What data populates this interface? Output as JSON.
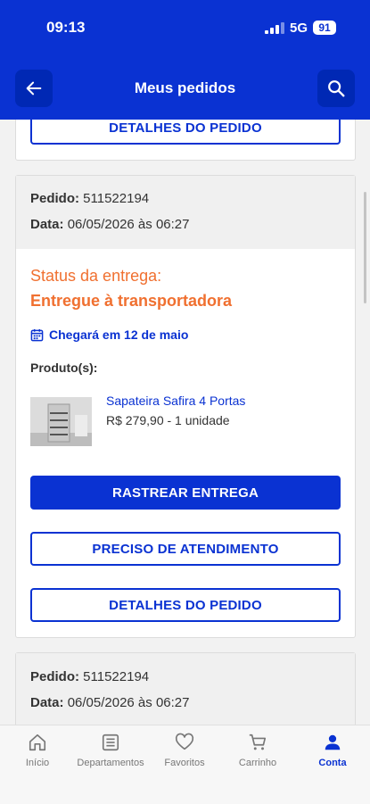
{
  "status_bar": {
    "time": "09:13",
    "network": "5G",
    "battery": "91"
  },
  "header": {
    "title": "Meus pedidos"
  },
  "prev_card": {
    "details_label": "DETALHES DO PEDIDO"
  },
  "order1": {
    "pedido_label": "Pedido:",
    "pedido_value": "511522194",
    "data_label": "Data:",
    "data_value": "06/05/2026 às 06:27",
    "status_label": "Status da entrega:",
    "status_value": "Entregue à transportadora",
    "arrival": "Chegará em 12 de maio",
    "products_label": "Produto(s):",
    "product_name": "Sapateira Safira 4 Portas",
    "product_price": "R$ 279,90 - 1 unidade",
    "track_label": "RASTREAR ENTREGA",
    "support_label": "PRECISO DE ATENDIMENTO",
    "details_label": "DETALHES DO PEDIDO"
  },
  "order2": {
    "pedido_label": "Pedido:",
    "pedido_value": "511522194",
    "data_label": "Data:",
    "data_value": "06/05/2026 às 06:27"
  },
  "nav": {
    "items": [
      {
        "label": "Início",
        "icon": "home-icon"
      },
      {
        "label": "Departamentos",
        "icon": "list-icon"
      },
      {
        "label": "Favoritos",
        "icon": "heart-icon"
      },
      {
        "label": "Carrinho",
        "icon": "cart-icon"
      },
      {
        "label": "Conta",
        "icon": "person-icon",
        "active": true
      }
    ]
  },
  "colors": {
    "brand": "#0a32d2",
    "status": "#f07030"
  }
}
